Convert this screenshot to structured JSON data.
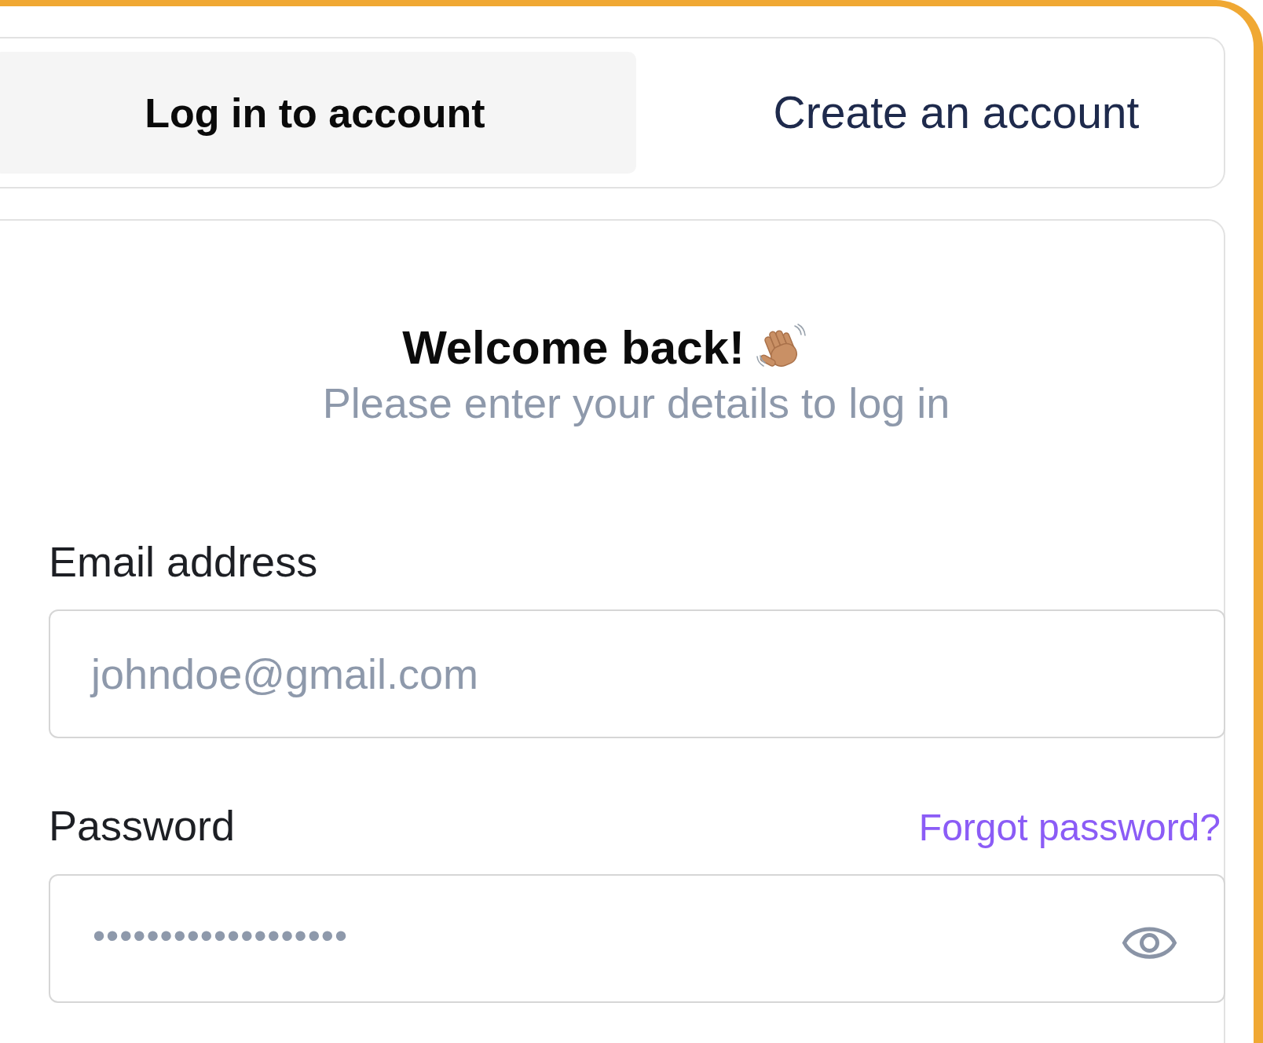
{
  "tabs": [
    {
      "label": "Log in to account",
      "selected": true
    },
    {
      "label": "Create an account",
      "selected": false
    }
  ],
  "login_card": {
    "title": "Welcome back!",
    "subtitle": "Please enter your details to log in",
    "fields": [
      {
        "kind": "email",
        "label": "Email address",
        "placeholder": "johndoe@gmail.com"
      },
      {
        "kind": "password",
        "label": "Password",
        "link": "Forgot password?",
        "value": "•••••••••••••••••••"
      }
    ]
  }
}
